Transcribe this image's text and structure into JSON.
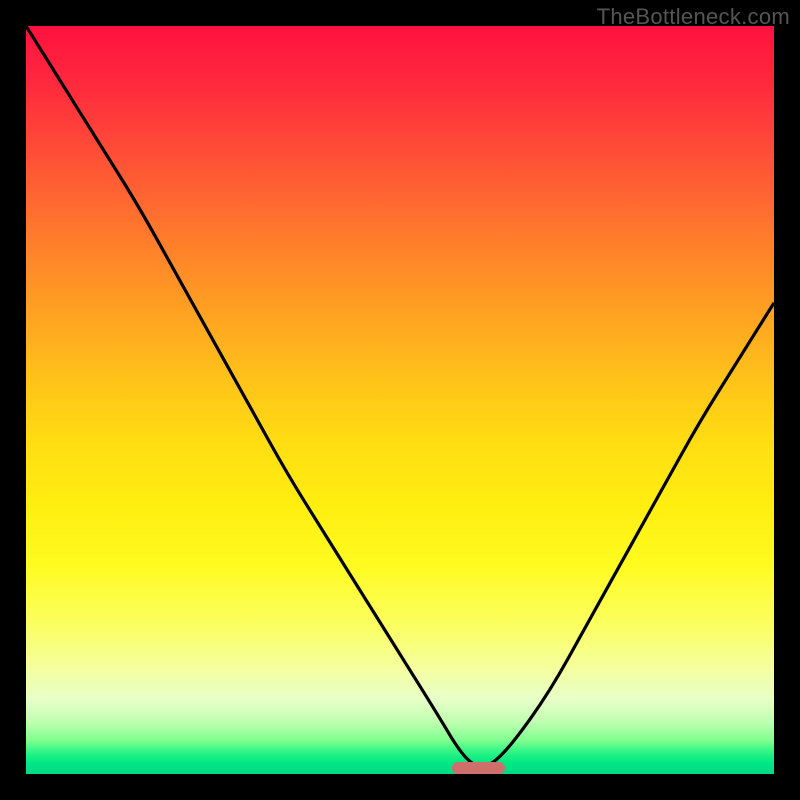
{
  "watermark": "TheBottleneck.com",
  "chart_data": {
    "type": "line",
    "title": "",
    "xlabel": "",
    "ylabel": "",
    "x_range": [
      0,
      100
    ],
    "y_range": [
      0,
      100
    ],
    "series": [
      {
        "name": "bottleneck-curve",
        "x": [
          0,
          5,
          10,
          15,
          20,
          25,
          30,
          35,
          40,
          45,
          50,
          55,
          58,
          60,
          62,
          65,
          70,
          75,
          80,
          85,
          90,
          95,
          100
        ],
        "values": [
          100,
          92,
          84,
          76,
          67,
          58,
          49,
          40,
          32,
          24,
          16,
          8,
          3,
          1,
          1,
          4,
          11,
          20,
          29,
          38,
          47,
          55,
          63
        ]
      }
    ],
    "minimum": {
      "x_start": 57,
      "x_end": 64,
      "y": 0.8
    },
    "background": {
      "type": "vertical-gradient",
      "top_color": "#ff113f",
      "bottom_color": "#00d884"
    }
  },
  "colors": {
    "curve": "#000000",
    "min_marker": "#cf6f6a",
    "frame": "#000000"
  }
}
